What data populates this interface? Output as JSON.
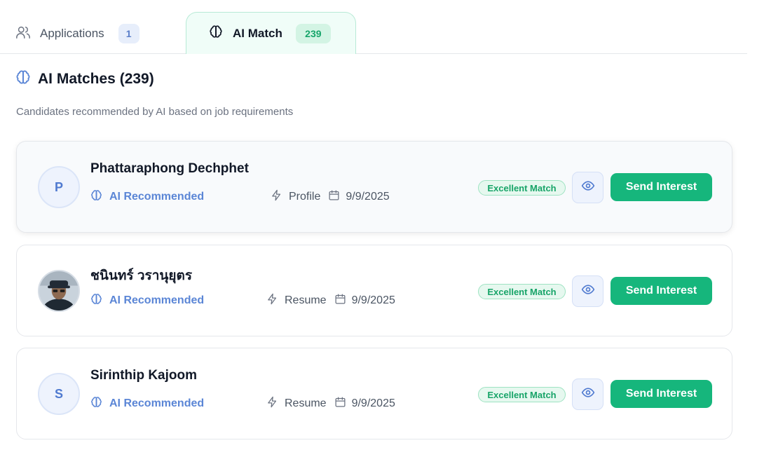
{
  "tabs": [
    {
      "label": "Applications",
      "count": "1",
      "icon": "users-icon"
    },
    {
      "label": "AI Match",
      "count": "239",
      "icon": "brain-icon"
    }
  ],
  "section": {
    "title": "AI Matches (239)",
    "subtitle": "Candidates recommended by AI based on job requirements"
  },
  "colors": {
    "accent_green": "#16b67c",
    "accent_blue": "#5b86d6"
  },
  "candidates": [
    {
      "initial": "P",
      "has_photo": false,
      "name": "Phattaraphong Dechphet",
      "tag": "AI Recommended",
      "source": "Profile",
      "date": "9/9/2025",
      "match": "Excellent Match",
      "action": "Send Interest"
    },
    {
      "initial": "",
      "has_photo": true,
      "name": "ชนินทร์ วรานุยุตร",
      "tag": "AI Recommended",
      "source": "Resume",
      "date": "9/9/2025",
      "match": "Excellent Match",
      "action": "Send Interest"
    },
    {
      "initial": "S",
      "has_photo": false,
      "name": "Sirinthip Kajoom",
      "tag": "AI Recommended",
      "source": "Resume",
      "date": "9/9/2025",
      "match": "Excellent Match",
      "action": "Send Interest"
    }
  ]
}
